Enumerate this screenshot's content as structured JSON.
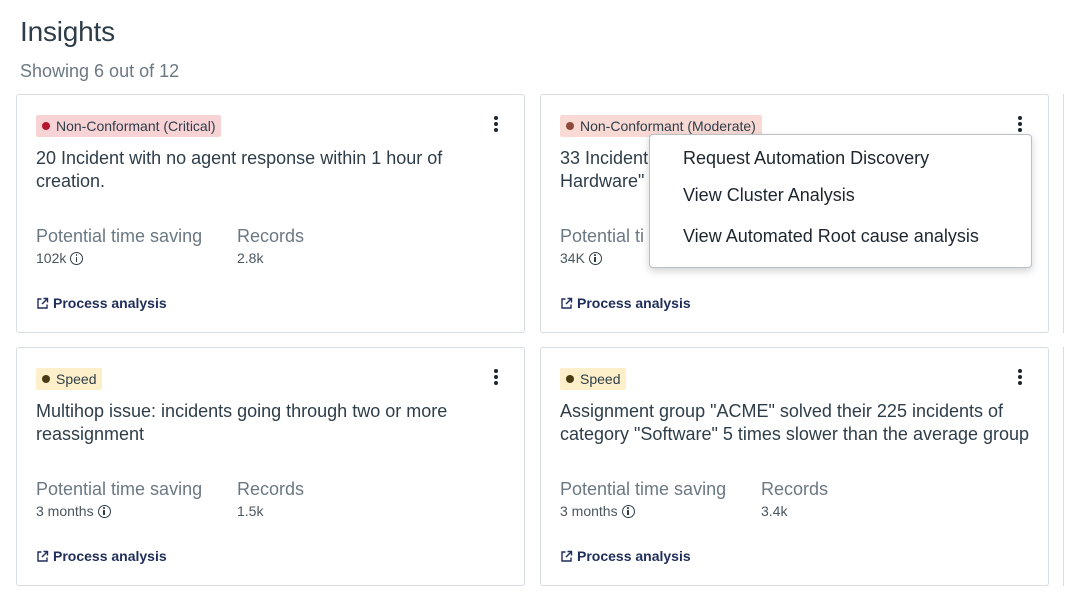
{
  "header": {
    "title": "Insights",
    "subtitle": "Showing 6 out of 12"
  },
  "cards": [
    {
      "badge": "Non-Conformant (Critical)",
      "badge_type": "critical",
      "title": "20 Incident with no agent response  within 1 hour of creation.",
      "time_label": "Potential time saving",
      "time_value": "102k",
      "records_label": "Records",
      "records_value": "2.8k",
      "link": "Process analysis"
    },
    {
      "badge": "Non-Conformant (Moderate)",
      "badge_type": "moderate",
      "title": "33 Incident\nHardware\"",
      "time_label": "Potential ti",
      "time_value": "34K",
      "records_label": "",
      "records_value": "",
      "link": "Process analysis"
    },
    {
      "badge": "Speed",
      "badge_type": "speed",
      "title": "Multihop issue: incidents going through two or more reassignment",
      "time_label": "Potential time saving",
      "time_value": "3 months",
      "records_label": "Records",
      "records_value": "1.5k",
      "link": "Process analysis"
    },
    {
      "badge": "Speed",
      "badge_type": "speed",
      "title": "Assignment group \"ACME\" solved their 225 incidents of category \"Software\" 5 times slower than the average group",
      "time_label": "Potential time saving",
      "time_value": "3 months",
      "records_label": "Records",
      "records_value": "3.4k",
      "link": "Process analysis"
    }
  ],
  "context_menu": {
    "items": [
      "Request Automation Discovery",
      "View Cluster Analysis",
      "View Automated Root cause analysis"
    ]
  },
  "colors": {
    "critical_bg": "#f8d3d6",
    "critical_dot": "#b4182f",
    "moderate_bg": "#f8d9d4",
    "speed_bg": "#fcefc9",
    "link": "#1f2d5a"
  },
  "icons": {
    "kebab": "more-vertical-icon",
    "info": "info-icon",
    "link": "external-link-icon"
  }
}
